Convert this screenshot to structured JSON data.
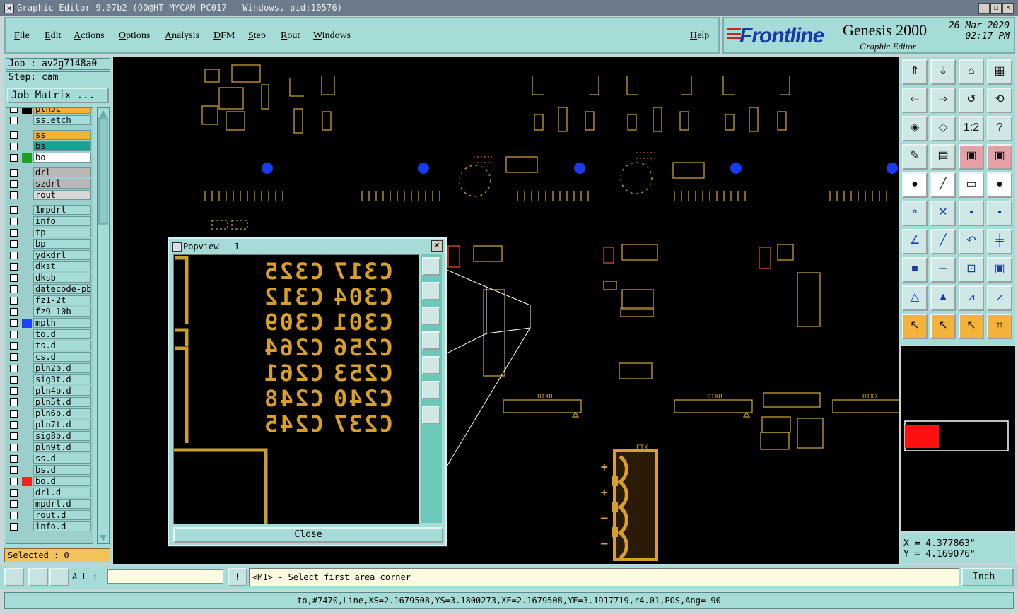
{
  "window": {
    "title": "Graphic Editor 9.07b2 (OO@HT-MYCAM-PC017 - Windows, pid:10576)"
  },
  "menu": {
    "items": [
      "File",
      "Edit",
      "Actions",
      "Options",
      "Analysis",
      "DFM",
      "Step",
      "Rout",
      "Windows"
    ],
    "help": "Help"
  },
  "brand": {
    "logo": "Frontline",
    "product": "Genesis 2000",
    "subtitle": "Graphic Editor",
    "date": "26 Mar 2020",
    "time": "02:17 PM"
  },
  "job": {
    "job_line": "Job : av2g7148a0",
    "step_line": "Step: cam",
    "matrix_button": "Job Matrix ..."
  },
  "layers": [
    {
      "name": "pln5c",
      "color": "#f3b23a",
      "swatch": "#000000"
    },
    {
      "name": "ss.etch",
      "color": "#a6dcd8",
      "swatch": ""
    },
    {
      "name": "ss",
      "color": "#f3b23a",
      "swatch": ""
    },
    {
      "name": "bs",
      "color": "#1aa090",
      "swatch": ""
    },
    {
      "name": "bo",
      "color": "#ffffff",
      "swatch": "#20a020"
    },
    {
      "name": "drl",
      "color": "#b8b8b8",
      "swatch": ""
    },
    {
      "name": "szdrl",
      "color": "#b8b8b8",
      "swatch": ""
    },
    {
      "name": "rout",
      "color": "#d8d8d8",
      "swatch": ""
    },
    {
      "name": "1mpdrl",
      "color": "#a6dcd8",
      "swatch": ""
    },
    {
      "name": "info",
      "color": "#a6dcd8",
      "swatch": ""
    },
    {
      "name": "tp",
      "color": "#a6dcd8",
      "swatch": ""
    },
    {
      "name": "bp",
      "color": "#a6dcd8",
      "swatch": ""
    },
    {
      "name": "ydkdrl",
      "color": "#a6dcd8",
      "swatch": ""
    },
    {
      "name": "dkst",
      "color": "#a6dcd8",
      "swatch": ""
    },
    {
      "name": "dksb",
      "color": "#a6dcd8",
      "swatch": ""
    },
    {
      "name": "datecode-pbe",
      "color": "#a6dcd8",
      "swatch": ""
    },
    {
      "name": "fz1-2t",
      "color": "#a6dcd8",
      "swatch": ""
    },
    {
      "name": "fz9-10b",
      "color": "#a6dcd8",
      "swatch": ""
    },
    {
      "name": "mpth",
      "color": "#a6dcd8",
      "swatch": "#2040ff"
    },
    {
      "name": "to.d",
      "color": "#a6dcd8",
      "swatch": ""
    },
    {
      "name": "ts.d",
      "color": "#a6dcd8",
      "swatch": ""
    },
    {
      "name": "cs.d",
      "color": "#a6dcd8",
      "swatch": ""
    },
    {
      "name": "pln2b.d",
      "color": "#a6dcd8",
      "swatch": ""
    },
    {
      "name": "sig3t.d",
      "color": "#a6dcd8",
      "swatch": ""
    },
    {
      "name": "pln4b.d",
      "color": "#a6dcd8",
      "swatch": ""
    },
    {
      "name": "pln5t.d",
      "color": "#a6dcd8",
      "swatch": ""
    },
    {
      "name": "pln6b.d",
      "color": "#a6dcd8",
      "swatch": ""
    },
    {
      "name": "pln7t.d",
      "color": "#a6dcd8",
      "swatch": ""
    },
    {
      "name": "sig8b.d",
      "color": "#a6dcd8",
      "swatch": ""
    },
    {
      "name": "pln9t.d",
      "color": "#a6dcd8",
      "swatch": ""
    },
    {
      "name": "ss.d",
      "color": "#a6dcd8",
      "swatch": ""
    },
    {
      "name": "bs.d",
      "color": "#a6dcd8",
      "swatch": ""
    },
    {
      "name": "bo.d",
      "color": "#a6dcd8",
      "swatch": "#ff2020"
    },
    {
      "name": "drl.d",
      "color": "#a6dcd8",
      "swatch": ""
    },
    {
      "name": "mpdrl.d",
      "color": "#a6dcd8",
      "swatch": ""
    },
    {
      "name": "rout.d",
      "color": "#a6dcd8",
      "swatch": ""
    },
    {
      "name": "info.d",
      "color": "#a6dcd8",
      "swatch": ""
    }
  ],
  "selected": "Selected : 0",
  "popview": {
    "title": "Popview - 1",
    "close_label": "Close",
    "close_x": "✕",
    "rows": [
      [
        "C325",
        "C317"
      ],
      [
        "C312",
        "C304"
      ],
      [
        "C309",
        "C301"
      ],
      [
        "C264",
        "C256"
      ],
      [
        "C261",
        "C253"
      ],
      [
        "C248",
        "C240"
      ],
      [
        "C245",
        "C237"
      ]
    ]
  },
  "canvas": {
    "board_labels": [
      "BTX8",
      "0TX8",
      "BTX7",
      "ETX"
    ],
    "polarity": [
      "+",
      "+",
      "–",
      "–"
    ]
  },
  "coords": {
    "x": "X = 4.377863\"",
    "y": "Y = 4.169076\""
  },
  "bottom": {
    "al_label": "A L :",
    "al_value": "",
    "bang": "!",
    "prompt": "<M1> - Select first area corner",
    "units": "Inch"
  },
  "status": {
    "text": "to,#7470,Line,XS=2.1679508,YS=3.1800273,XE=2.1679508,YE=3.1917719,r4.01,POS,Ang=-90"
  },
  "colors": {
    "panel": "#a6dcd8",
    "canvas": "#000000",
    "feature": "#c8a030",
    "accent_blue": "#1a3aa8"
  },
  "window_buttons": [
    "_",
    "□",
    "×"
  ]
}
